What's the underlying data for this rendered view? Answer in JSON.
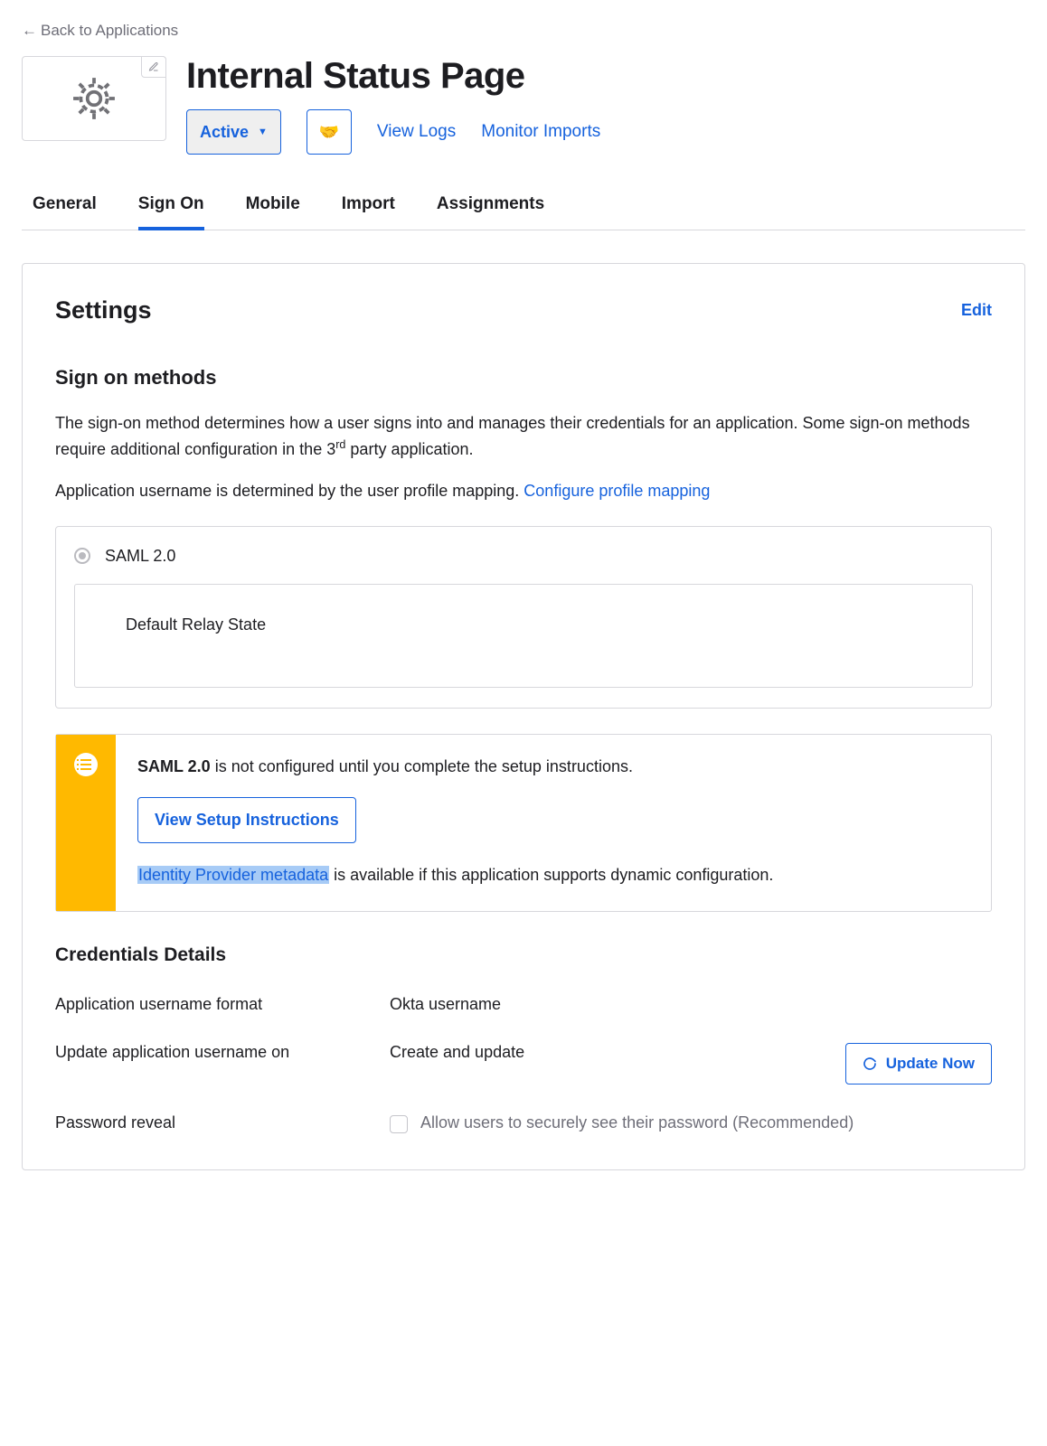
{
  "backLink": "Back to Applications",
  "appTitle": "Internal Status Page",
  "activeLabel": "Active",
  "viewLogs": "View Logs",
  "monitorImports": "Monitor Imports",
  "tabs": [
    "General",
    "Sign On",
    "Mobile",
    "Import",
    "Assignments"
  ],
  "activeTab": "Sign On",
  "settings": {
    "title": "Settings",
    "editLabel": "Edit",
    "signOnMethods": {
      "heading": "Sign on methods",
      "desc1a": "The sign-on method determines how a user signs into and manages their credentials for an application. Some sign-on methods require additional configuration in the 3",
      "desc1sup": "rd",
      "desc1b": " party application.",
      "desc2a": "Application username is determined by the user profile mapping. ",
      "configureLink": "Configure profile mapping",
      "radioLabel": "SAML 2.0",
      "relayLabel": "Default Relay State"
    },
    "alert": {
      "boldPrefix": "SAML 2.0",
      "msgTail": " is not configured until you complete the setup instructions.",
      "setupBtn": "View Setup Instructions",
      "idpLink": "Identity Provider metadata",
      "idpTail": " is available if this application supports dynamic configuration."
    },
    "credentials": {
      "heading": "Credentials Details",
      "rows": {
        "usernameFormat": {
          "label": "Application username format",
          "value": "Okta username"
        },
        "updateOn": {
          "label": "Update application username on",
          "value": "Create and update",
          "updateBtn": "Update Now"
        },
        "passwordReveal": {
          "label": "Password reveal",
          "checkboxLabel": "Allow users to securely see their password (Recommended)"
        }
      }
    }
  }
}
